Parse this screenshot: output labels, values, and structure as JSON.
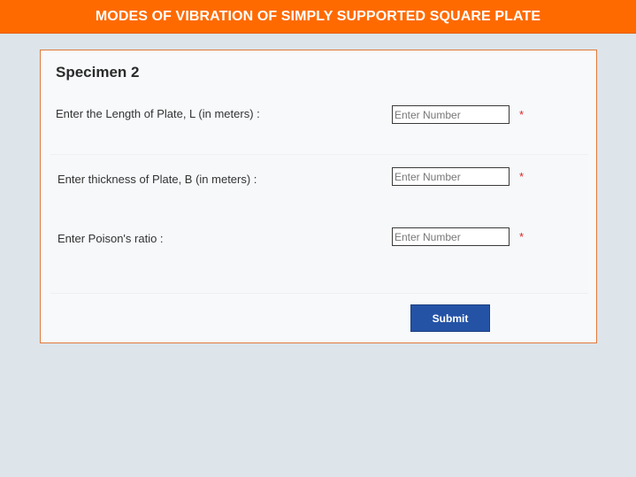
{
  "header": {
    "title": "MODES OF VIBRATION OF SIMPLY SUPPORTED SQUARE PLATE"
  },
  "form": {
    "section_title": "Specimen 2",
    "fields": [
      {
        "label": "Enter the Length of Plate, L (in meters) :",
        "placeholder": "Enter Number",
        "value": "",
        "required_mark": "*"
      },
      {
        "label": "Enter thickness of Plate, B (in meters) :",
        "placeholder": "Enter Number",
        "value": "",
        "required_mark": "*"
      },
      {
        "label": "Enter Poison's ratio :",
        "placeholder": "Enter Number",
        "value": "",
        "required_mark": "*"
      }
    ],
    "submit_label": "Submit"
  },
  "colors": {
    "header_bg": "#ff6a00",
    "card_border": "#e07a3c",
    "button_bg": "#2453a6",
    "required": "#e02424",
    "page_bg": "#dde4ea"
  }
}
